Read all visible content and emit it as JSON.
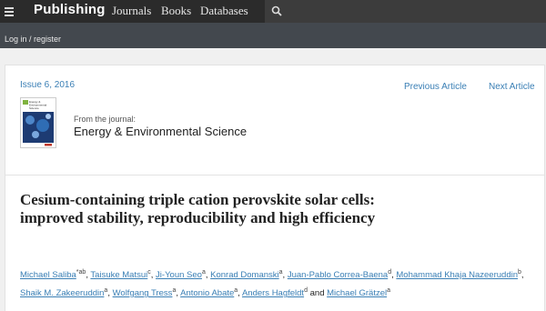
{
  "nav": {
    "brand": "Publishing",
    "links": [
      "Journals",
      "Books",
      "Databases"
    ]
  },
  "subbar": {
    "login": "Log in / register"
  },
  "article_nav": {
    "issue": "Issue 6, 2016",
    "previous": "Previous Article",
    "next": "Next Article"
  },
  "journal": {
    "from_label": "From the journal:",
    "name": "Energy & Environmental Science",
    "cover_title": "Energy & Environmental Science"
  },
  "article": {
    "title": "Cesium-containing triple cation perovskite solar cells: improved stability, reproducibility and high efficiency",
    "authors": [
      {
        "name": "Michael Saliba",
        "sup": "*ab"
      },
      {
        "name": "Taisuke Matsui",
        "sup": "c"
      },
      {
        "name": "Ji-Youn Seo",
        "sup": "a"
      },
      {
        "name": "Konrad Domanski",
        "sup": "a"
      },
      {
        "name": "Juan-Pablo Correa-Baena",
        "sup": "d"
      },
      {
        "name": "Mohammad Khaja Nazeeruddin",
        "sup": "b"
      },
      {
        "name": "Shaik M. Zakeeruddin",
        "sup": "a"
      },
      {
        "name": "Wolfgang Tress",
        "sup": "a"
      },
      {
        "name": "Antonio Abate",
        "sup": "a"
      },
      {
        "name": "Anders Hagfeldt",
        "sup": "d"
      },
      {
        "name": "Michael Grätzel",
        "sup": "a"
      }
    ],
    "and_word": "and"
  },
  "colors": {
    "link": "#3a7fb5",
    "topbar": "#2b2b2b",
    "subbar": "#43484e"
  }
}
